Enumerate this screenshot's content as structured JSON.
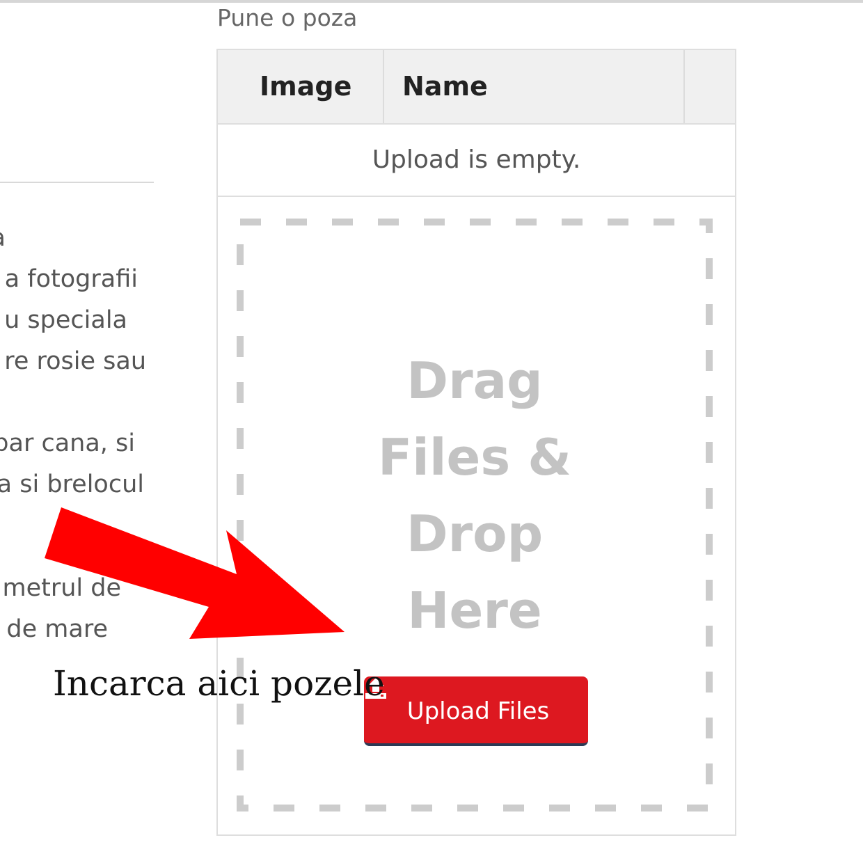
{
  "upload_section": {
    "title": "Pune o poza",
    "table": {
      "columns": [
        "Image",
        "Name",
        ""
      ],
      "empty_message": "Upload is empty."
    },
    "dropzone": {
      "lines": [
        "Drag",
        "Files &",
        "Drop",
        "Here"
      ]
    },
    "upload_button": {
      "label": "Upload Files",
      "icon": "upload-icon",
      "color": "#dd1820"
    }
  },
  "left_description": {
    "lines": [
      "a",
      "a fotografii",
      "u speciala",
      "re rosie sau",
      "",
      "par cana, si",
      "a si brelocul",
      "",
      "",
      "metrul de",
      "de mare"
    ]
  },
  "annotation": {
    "caption": "Incarca aici pozele",
    "arrow_color": "#ff0000"
  }
}
